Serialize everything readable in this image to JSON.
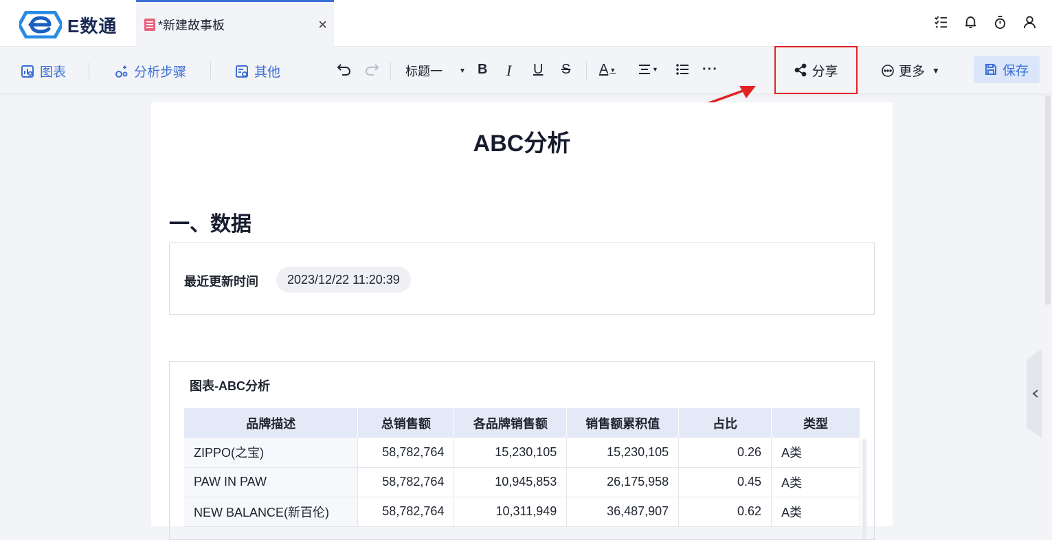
{
  "app": {
    "name": "E数通",
    "tab_title": "*新建故事板",
    "tab_close": "×"
  },
  "toolbar": {
    "chart_label": "图表",
    "steps_label": "分析步骤",
    "other_label": "其他",
    "heading_select": "标题一",
    "bold": "B",
    "italic": "I",
    "underline": "U",
    "strike": "S",
    "font_color": "A",
    "more_dots": "···",
    "share_label": "分享",
    "more_label": "更多",
    "save_label": "保存"
  },
  "document": {
    "title": "ABC分析",
    "section_heading": "一、数据",
    "update_label": "最近更新时间",
    "update_time": "2023/12/22 11:20:39",
    "chart_title": "图表-ABC分析",
    "table": {
      "headers": [
        "品牌描述",
        "总销售额",
        "各品牌销售额",
        "销售额累积值",
        "占比",
        "类型"
      ],
      "rows": [
        [
          "ZIPPO(之宝)",
          "58,782,764",
          "15,230,105",
          "15,230,105",
          "0.26",
          "A类"
        ],
        [
          "PAW IN PAW",
          "58,782,764",
          "10,945,853",
          "26,175,958",
          "0.45",
          "A类"
        ],
        [
          "NEW BALANCE(新百伦)",
          "58,782,764",
          "10,311,949",
          "36,487,907",
          "0.62",
          "A类"
        ]
      ]
    }
  },
  "colors": {
    "accent": "#3b6fd8",
    "highlight_border": "#e02424",
    "annotation_arrow": "#e02424",
    "table_header_bg": "#e3e9f6"
  },
  "icons": {
    "logo": "e-logo-icon",
    "tab_doc": "document-icon",
    "top": [
      "task-list-icon",
      "bell-icon",
      "timer-icon",
      "user-icon"
    ],
    "share": "share-icon",
    "more": "ellipsis-circle-icon",
    "save": "floppy-disk-icon"
  }
}
